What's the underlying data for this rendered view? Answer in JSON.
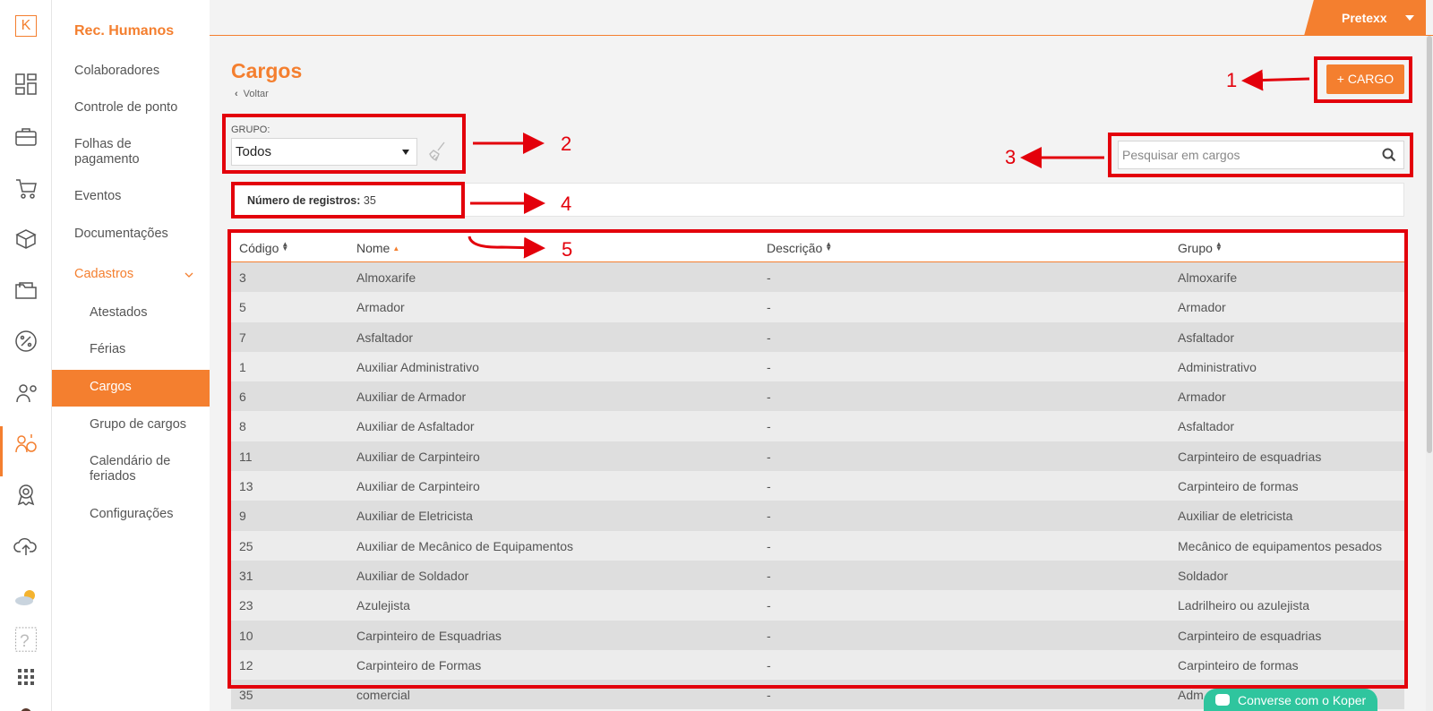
{
  "app": {
    "module_title": "Rec. Humanos",
    "user_name": "Pretexx"
  },
  "sidebar": {
    "items": [
      {
        "label": "Colaboradores"
      },
      {
        "label": "Controle de ponto"
      },
      {
        "label": "Folhas de pagamento"
      },
      {
        "label": "Eventos"
      },
      {
        "label": "Documentações"
      },
      {
        "label": "Cadastros"
      }
    ],
    "sub_items": [
      {
        "label": "Atestados"
      },
      {
        "label": "Férias"
      },
      {
        "label": "Cargos"
      },
      {
        "label": "Grupo de cargos"
      },
      {
        "label": "Calendário de feriados"
      },
      {
        "label": "Configurações"
      }
    ]
  },
  "page": {
    "title": "Cargos",
    "back_label": "Voltar",
    "add_button_label": "+ CARGO",
    "group_label": "GRUPO:",
    "group_value": "Todos",
    "search_placeholder": "Pesquisar em cargos",
    "records_label": "Número de registros:",
    "records_count": "35"
  },
  "table": {
    "columns": [
      "Código",
      "Nome",
      "Descrição",
      "Grupo"
    ],
    "rows": [
      [
        "3",
        "Almoxarife",
        "-",
        "Almoxarife"
      ],
      [
        "5",
        "Armador",
        "-",
        "Armador"
      ],
      [
        "7",
        "Asfaltador",
        "-",
        "Asfaltador"
      ],
      [
        "1",
        "Auxiliar Administrativo",
        "-",
        "Administrativo"
      ],
      [
        "6",
        "Auxiliar de Armador",
        "-",
        "Armador"
      ],
      [
        "8",
        "Auxiliar de Asfaltador",
        "-",
        "Asfaltador"
      ],
      [
        "11",
        "Auxiliar de Carpinteiro",
        "-",
        "Carpinteiro de esquadrias"
      ],
      [
        "13",
        "Auxiliar de Carpinteiro",
        "-",
        "Carpinteiro de formas"
      ],
      [
        "9",
        "Auxiliar de Eletricista",
        "-",
        "Auxiliar de eletricista"
      ],
      [
        "25",
        "Auxiliar de Mecânico de Equipamentos",
        "-",
        "Mecânico de equipamentos pesados"
      ],
      [
        "31",
        "Auxiliar de Soldador",
        "-",
        "Soldador"
      ],
      [
        "23",
        "Azulejista",
        "-",
        "Ladrilheiro ou azulejista"
      ],
      [
        "10",
        "Carpinteiro de Esquadrias",
        "-",
        "Carpinteiro de esquadrias"
      ],
      [
        "12",
        "Carpinteiro de Formas",
        "-",
        "Carpinteiro de formas"
      ],
      [
        "35",
        "comercial",
        "-",
        "Adm"
      ]
    ]
  },
  "annotations": [
    "1",
    "2",
    "3",
    "4",
    "5"
  ],
  "chat": {
    "label": "Converse com o Koper"
  },
  "colors": {
    "accent": "#f47f2f",
    "annotation": "#e3000b",
    "chat": "#2fc59e"
  }
}
